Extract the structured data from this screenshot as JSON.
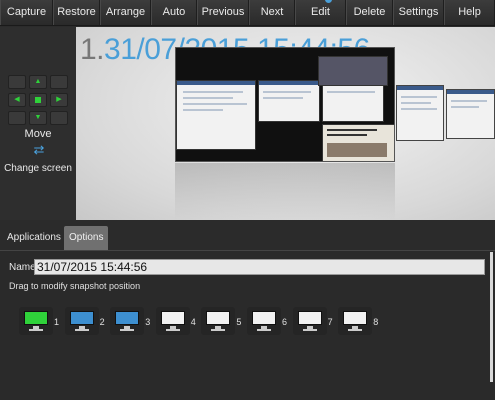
{
  "toolbar": {
    "items": [
      {
        "label": "Capture"
      },
      {
        "label": "Restore"
      },
      {
        "label": "Arrange"
      },
      {
        "label": "Auto"
      },
      {
        "label": "Previous"
      },
      {
        "label": "Next"
      },
      {
        "label": "Edit"
      },
      {
        "label": "Delete"
      },
      {
        "label": "Settings"
      },
      {
        "label": "Help"
      }
    ]
  },
  "left_panel": {
    "move_label": "Move",
    "change_screen_label": "Change screen",
    "arrow_glyphs": {
      "up": "▲",
      "down": "▼",
      "left": "◀",
      "right": "▶"
    }
  },
  "preview": {
    "snapshot_number": "1.",
    "snapshot_datetime": "31/07/2015 15:44:56"
  },
  "tabs": [
    {
      "label": "Applications",
      "active": false
    },
    {
      "label": "Options",
      "active": true
    }
  ],
  "options": {
    "name_label": "Name:",
    "name_value": "31/07/2015 15:44:56",
    "hint": "Drag to modify snapshot position",
    "screens": [
      {
        "number": "1",
        "state": "current",
        "color": "#2fd23a"
      },
      {
        "number": "2",
        "state": "used",
        "color": "#3d8fd0"
      },
      {
        "number": "3",
        "state": "used",
        "color": "#3d8fd0"
      },
      {
        "number": "4",
        "state": "empty",
        "color": "#f2f2f2"
      },
      {
        "number": "5",
        "state": "empty",
        "color": "#f2f2f2"
      },
      {
        "number": "6",
        "state": "empty",
        "color": "#f2f2f2"
      },
      {
        "number": "7",
        "state": "empty",
        "color": "#f2f2f2"
      },
      {
        "number": "8",
        "state": "empty",
        "color": "#f2f2f2"
      }
    ]
  },
  "colors": {
    "accent": "#4a9fd8",
    "active_green": "#2fd23a"
  }
}
